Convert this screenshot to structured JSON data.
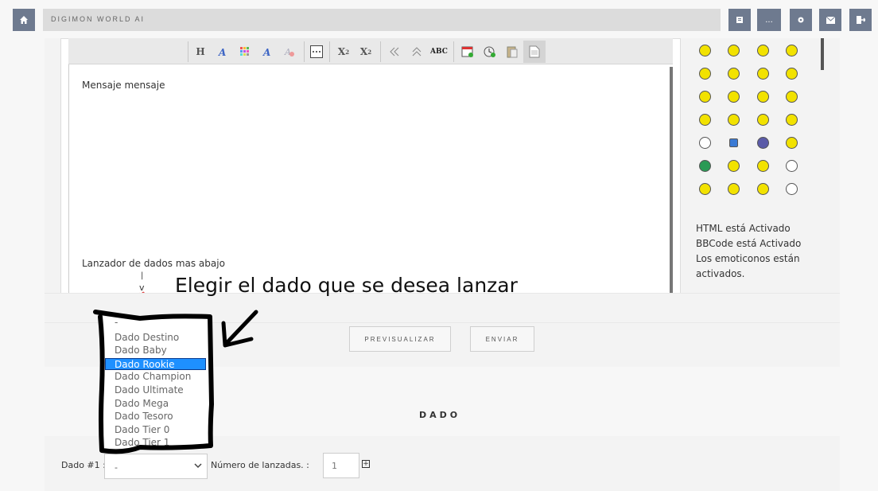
{
  "header": {
    "site_title": "DIGIMON WORLD AI",
    "buttons": [
      {
        "icon": "home-icon"
      },
      {
        "icon": "list-icon"
      },
      {
        "label": "...",
        "icon": "more-icon"
      },
      {
        "icon": "gear-icon"
      },
      {
        "icon": "mail-icon"
      },
      {
        "icon": "logout-icon"
      }
    ]
  },
  "editor": {
    "toolbar": [
      "heading",
      "font-color",
      "palette",
      "font-style",
      "remove-format",
      "horizontal-rule",
      "subscript",
      "superscript",
      "undo",
      "redo",
      "spellcheck",
      "date",
      "time",
      "paste",
      "source"
    ],
    "toolbar_labels": {
      "heading": "H",
      "subscript": "X",
      "superscript": "X",
      "spell": "ABC"
    },
    "line1": "Mensaje mensaje",
    "line2": "Lanzador de dados mas abajo",
    "arrow_mark": "|",
    "arrow_v": "v"
  },
  "sidebar": {
    "info": [
      "HTML está Activado",
      "BBCode está Activado",
      "Los emoticonos están",
      "activados."
    ]
  },
  "annotation": "Elegir el dado que se desea lanzar",
  "buttons": {
    "preview": "PREVISUALIZAR",
    "send": "ENVIAR"
  },
  "dado_section": {
    "title": "DADO",
    "dado1_label": "Dado #1 :",
    "dado1_value": "-",
    "lanzadas_label": "Número de lanzadas. :",
    "lanzadas_value": "1",
    "plus": "+"
  },
  "dropdown": {
    "options": [
      "-",
      "Dado Destino",
      "Dado Baby",
      "Dado Rookie",
      "Dado Champion",
      "Dado Ultimate",
      "Dado Mega",
      "Dado Tesoro",
      "Dado Tier 0",
      "Dado Tier 1"
    ],
    "selected": "Dado Rookie"
  },
  "colors": {
    "header_button": "#6e7a8f",
    "selected_option": "#1e90ff",
    "emoji_yellow": "#f2e200"
  }
}
